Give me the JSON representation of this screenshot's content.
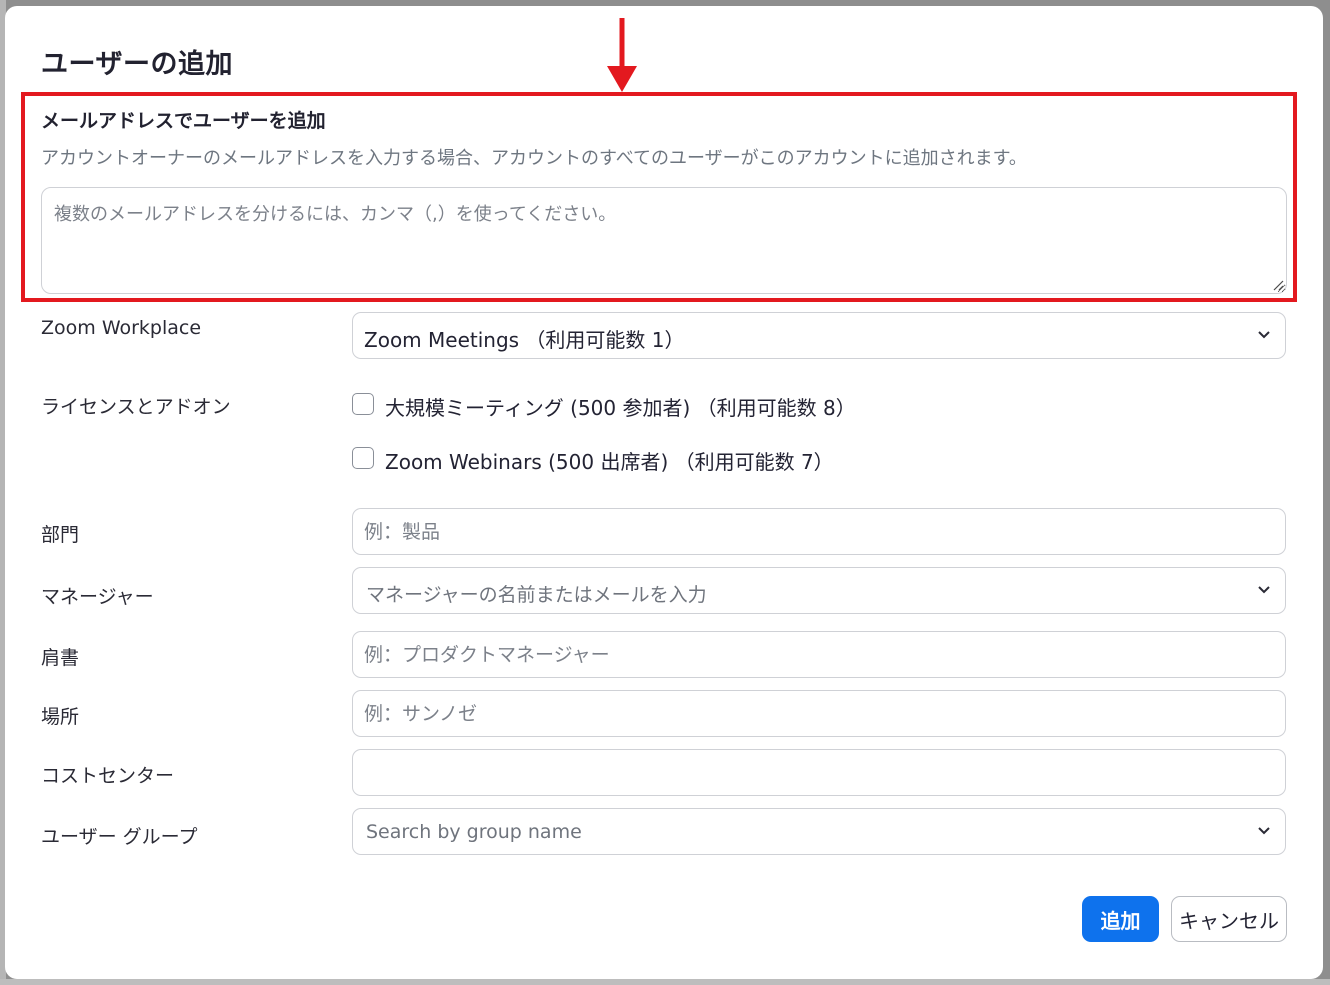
{
  "dialog": {
    "title": "ユーザーの追加"
  },
  "email_section": {
    "heading": "メールアドレスでユーザーを追加",
    "description": "アカウントオーナーのメールアドレスを入力する場合、アカウントのすべてのユーザーがこのアカウントに追加されます。",
    "placeholder": "複数のメールアドレスを分けるには、カンマ（,）を使ってください。",
    "value": ""
  },
  "workplace": {
    "label": "Zoom Workplace",
    "selected": "Zoom Meetings （利用可能数 1）"
  },
  "licenses": {
    "label": "ライセンスとアドオン",
    "items": [
      {
        "label": "大規模ミーティング (500 参加者) （利用可能数 8）",
        "checked": false
      },
      {
        "label": "Zoom Webinars (500 出席者) （利用可能数 7）",
        "checked": false
      }
    ]
  },
  "department": {
    "label": "部門",
    "placeholder": "例：製品"
  },
  "manager": {
    "label": "マネージャー",
    "placeholder": "マネージャーの名前またはメールを入力"
  },
  "job_title": {
    "label": "肩書",
    "placeholder": "例：プロダクトマネージャー"
  },
  "location": {
    "label": "場所",
    "placeholder": "例：サンノゼ"
  },
  "cost_center": {
    "label": "コストセンター",
    "placeholder": ""
  },
  "user_group": {
    "label": "ユーザー グループ",
    "placeholder": "Search by group name"
  },
  "buttons": {
    "add": "追加",
    "cancel": "キャンセル"
  },
  "colors": {
    "primary": "#0e72ed",
    "highlight": "#e3191f",
    "text": "#232333",
    "muted": "#6e7680"
  },
  "icons": [
    "red-arrow-down-icon",
    "chevron-down-icon",
    "resize-grip-icon"
  ]
}
